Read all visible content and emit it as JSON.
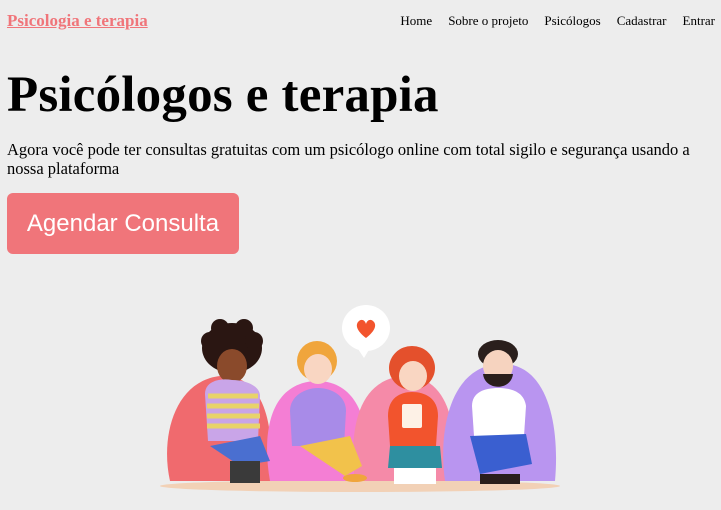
{
  "header": {
    "brand": "Psicologia e terapia",
    "nav": [
      "Home",
      "Sobre o projeto",
      "Psicólogos",
      "Cadastrar",
      "Entrar"
    ]
  },
  "hero": {
    "title": "Psicólogos e terapia",
    "description": "Agora você pode ter consultas gratuitas com um psicólogo online com total sigilo e segurança usando a nossa plataforma",
    "cta_label": "Agendar Consulta"
  },
  "colors": {
    "accent": "#f0757a",
    "background": "#ededed"
  },
  "illustration": {
    "icons": [
      "heart-speech-bubble-icon"
    ]
  }
}
